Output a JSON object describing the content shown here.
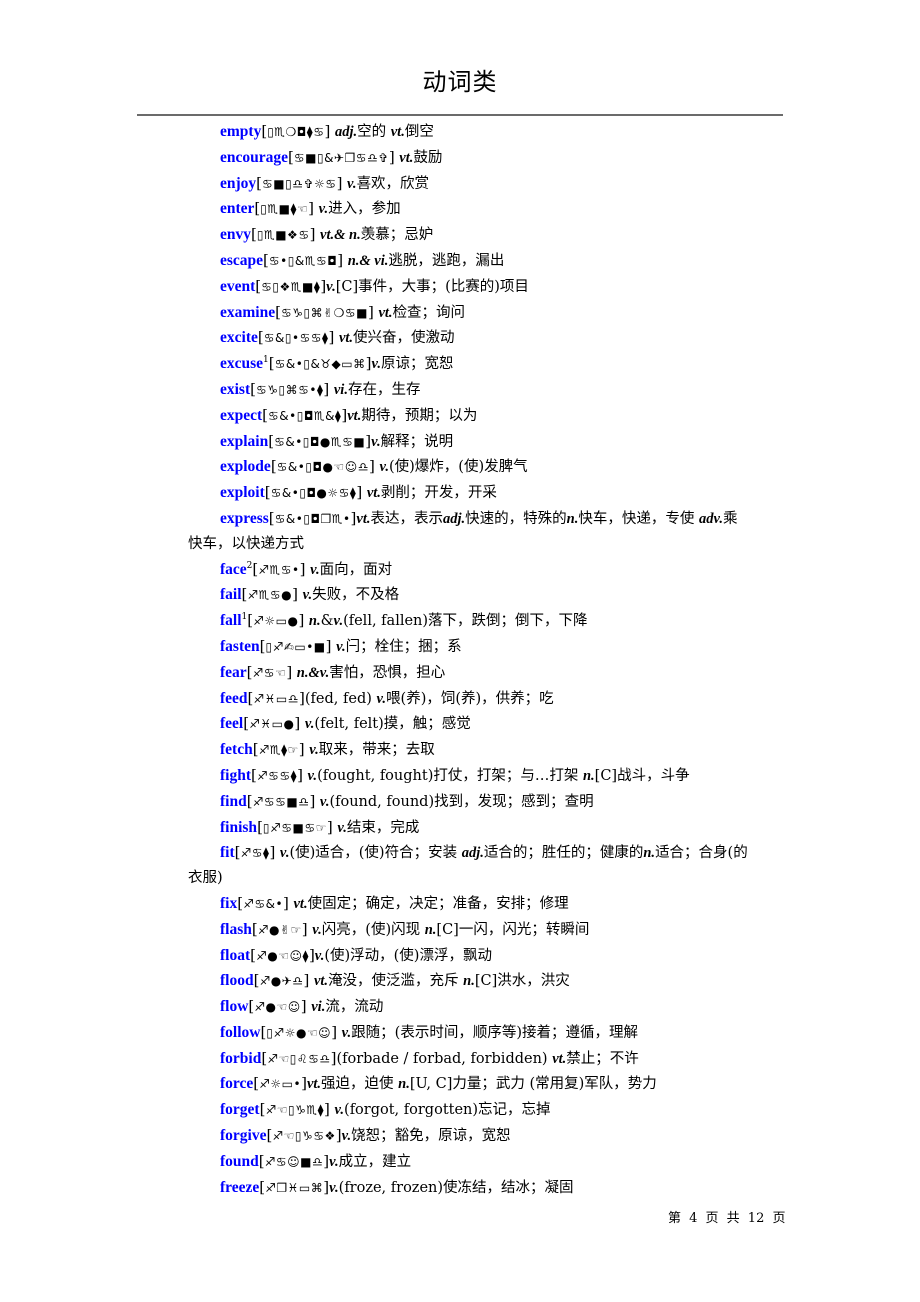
{
  "document": {
    "title": "动词类",
    "footer": "第 4 页 共 12 页"
  },
  "entries": [
    {
      "word": "empty",
      "sup": "",
      "phonetic": "▯♏❍◘⧫♋",
      "segments": [
        {
          "t": " "
        },
        {
          "pos": "adj."
        },
        {
          "t": "空的  "
        },
        {
          "pos": "vt."
        },
        {
          "t": "倒空"
        }
      ]
    },
    {
      "word": "encourage",
      "sup": "",
      "phonetic": "♋■▯&✈❐♋♎✞",
      "segments": [
        {
          "t": " "
        },
        {
          "pos": "vt."
        },
        {
          "t": "鼓励"
        }
      ]
    },
    {
      "word": "enjoy",
      "sup": "",
      "phonetic": "♋■▯♎✞☼♋",
      "segments": [
        {
          "t": " "
        },
        {
          "pos": "v."
        },
        {
          "t": "喜欢，欣赏"
        }
      ]
    },
    {
      "word": "enter",
      "sup": "",
      "phonetic": "▯♏■⧫☜",
      "segments": [
        {
          "t": " "
        },
        {
          "pos": "v."
        },
        {
          "t": "进入，参加"
        }
      ]
    },
    {
      "word": "envy",
      "sup": "",
      "phonetic": "▯♏■❖♋",
      "segments": [
        {
          "t": " "
        },
        {
          "pos": "vt.& n."
        },
        {
          "t": "羡慕；忌妒"
        }
      ]
    },
    {
      "word": "escape",
      "sup": "",
      "phonetic": "♋•▯&♏♋◘",
      "segments": [
        {
          "t": " "
        },
        {
          "pos": "n.& vi."
        },
        {
          "t": "逃脱，逃跑，漏出"
        }
      ]
    },
    {
      "word": "event",
      "sup": "",
      "phonetic": "♋▯❖♏■⧫",
      "segments": [
        {
          "pos": "v."
        },
        {
          "t": "[C]事件，大事；(比赛的)项目"
        }
      ]
    },
    {
      "word": "examine",
      "sup": "",
      "phonetic": "♋♑▯⌘✌❍♋■",
      "segments": [
        {
          "t": " "
        },
        {
          "pos": "vt."
        },
        {
          "t": "检查；询问"
        }
      ]
    },
    {
      "word": "excite",
      "sup": "",
      "phonetic": "♋&▯•♋♋⧫",
      "segments": [
        {
          "t": " "
        },
        {
          "pos": "vt."
        },
        {
          "t": "使兴奋，使激动"
        }
      ]
    },
    {
      "word": "excuse",
      "sup": "1",
      "phonetic": "♋&•▯&♉◆▭⌘",
      "segments": [
        {
          "pos": "v."
        },
        {
          "t": "原谅；宽恕"
        }
      ]
    },
    {
      "word": "exist",
      "sup": "",
      "phonetic": "♋♑▯⌘♋•⧫",
      "segments": [
        {
          "t": " "
        },
        {
          "pos": "vi."
        },
        {
          "t": "存在，生存"
        }
      ]
    },
    {
      "word": "expect",
      "sup": "",
      "phonetic": "♋&•▯◘♏&⧫",
      "segments": [
        {
          "pos": "vt."
        },
        {
          "t": "期待，预期；以为"
        }
      ]
    },
    {
      "word": "explain",
      "sup": "",
      "phonetic": "♋&•▯◘●♏♋■",
      "segments": [
        {
          "pos": "v."
        },
        {
          "t": "解释；说明"
        }
      ]
    },
    {
      "word": "explode",
      "sup": "",
      "phonetic": "♋&•▯◘●☜☺♎",
      "segments": [
        {
          "t": " "
        },
        {
          "pos": "v."
        },
        {
          "t": "(使)爆炸，(使)发脾气"
        }
      ]
    },
    {
      "word": "exploit",
      "sup": "",
      "phonetic": "♋&•▯◘●☼♋⧫",
      "segments": [
        {
          "t": " "
        },
        {
          "pos": "vt."
        },
        {
          "t": "剥削；开发，开采"
        }
      ]
    },
    {
      "word": "express",
      "sup": "",
      "phonetic": "♋&•▯◘❐♏•",
      "segments": [
        {
          "pos": "vt."
        },
        {
          "t": "表达，表示"
        },
        {
          "pos": "adj."
        },
        {
          "t": "快速的，特殊的"
        },
        {
          "pos": "n."
        },
        {
          "t": "快车，快递，专使  "
        },
        {
          "pos": "adv."
        },
        {
          "t": "乘快车，以快递方式"
        }
      ]
    },
    {
      "word": "face",
      "sup": "2",
      "phonetic": "♐♏♋•",
      "segments": [
        {
          "t": " "
        },
        {
          "pos": "v."
        },
        {
          "t": "面向，面对"
        }
      ]
    },
    {
      "word": "fail",
      "sup": "",
      "phonetic": "♐♏♋●",
      "segments": [
        {
          "t": " "
        },
        {
          "pos": "v."
        },
        {
          "t": "失败，不及格"
        }
      ]
    },
    {
      "word": "fall",
      "sup": "1",
      "phonetic": "♐☼▭●",
      "segments": [
        {
          "t": " "
        },
        {
          "pos": "n."
        },
        {
          "t": "&"
        },
        {
          "pos": "v."
        },
        {
          "t": "(fell,  fallen)落下，跌倒；倒下，下降"
        }
      ]
    },
    {
      "word": "fasten",
      "sup": "",
      "phonetic": "▯♐✍▭•■",
      "segments": [
        {
          "t": " "
        },
        {
          "pos": "v."
        },
        {
          "t": "闩；栓住；捆；系"
        }
      ]
    },
    {
      "word": "fear",
      "sup": "",
      "phonetic": "♐♋☜",
      "segments": [
        {
          "t": " "
        },
        {
          "pos": "n.&v."
        },
        {
          "t": "害怕，恐惧，担心"
        }
      ]
    },
    {
      "word": "feed",
      "sup": "",
      "phonetic": "♐♓▭♎",
      "segments": [
        {
          "t": "(fed,  fed)  "
        },
        {
          "pos": "v."
        },
        {
          "t": "喂(养)，饲(养)，供养；吃"
        }
      ]
    },
    {
      "word": "feel",
      "sup": "",
      "phonetic": "♐♓▭●",
      "segments": [
        {
          "t": " "
        },
        {
          "pos": "v."
        },
        {
          "t": "(felt,  felt)摸，触；感觉"
        }
      ]
    },
    {
      "word": "fetch",
      "sup": "",
      "phonetic": "♐♏⧫☞",
      "segments": [
        {
          "t": " "
        },
        {
          "pos": "v."
        },
        {
          "t": "取来，带来；去取"
        }
      ]
    },
    {
      "word": "fight",
      "sup": "",
      "phonetic": "♐♋♋⧫",
      "segments": [
        {
          "t": " "
        },
        {
          "pos": "v."
        },
        {
          "t": "(fought,  fought)打仗，打架；与…打架  "
        },
        {
          "pos": "n."
        },
        {
          "t": "[C]战斗，斗争"
        }
      ]
    },
    {
      "word": "find",
      "sup": "",
      "phonetic": "♐♋♋■♎",
      "segments": [
        {
          "t": " "
        },
        {
          "pos": "v."
        },
        {
          "t": "(found,  found)找到，发现；感到；查明"
        }
      ]
    },
    {
      "word": "finish",
      "sup": "",
      "phonetic": "▯♐♋■♋☞",
      "segments": [
        {
          "t": " "
        },
        {
          "pos": "v."
        },
        {
          "t": "结束，完成"
        }
      ]
    },
    {
      "word": "fit",
      "sup": "",
      "phonetic": "♐♋⧫",
      "segments": [
        {
          "t": " "
        },
        {
          "pos": "v."
        },
        {
          "t": "(使)适合，(使)符合；安装  "
        },
        {
          "pos": "adj."
        },
        {
          "t": "适合的；胜任的；健康的"
        },
        {
          "pos": "n."
        },
        {
          "t": "适合；合身(的衣服)"
        }
      ]
    },
    {
      "word": "fix",
      "sup": "",
      "phonetic": "♐♋&•",
      "segments": [
        {
          "t": " "
        },
        {
          "pos": "vt."
        },
        {
          "t": "使固定；确定，决定；准备，安排；修理"
        }
      ]
    },
    {
      "word": "flash",
      "sup": "",
      "phonetic": "♐●✌☞",
      "segments": [
        {
          "t": " "
        },
        {
          "pos": "v."
        },
        {
          "t": "闪亮，(使)闪现  "
        },
        {
          "pos": "n."
        },
        {
          "t": "[C]一闪，闪光；转瞬间"
        }
      ]
    },
    {
      "word": "float",
      "sup": "",
      "phonetic": "♐●☜☺⧫",
      "segments": [
        {
          "pos": "v."
        },
        {
          "t": "(使)浮动，(使)漂浮，飘动"
        }
      ]
    },
    {
      "word": "flood",
      "sup": "",
      "phonetic": "♐●✈♎",
      "segments": [
        {
          "t": " "
        },
        {
          "pos": "vt."
        },
        {
          "t": "淹没，使泛滥，充斥  "
        },
        {
          "pos": "n."
        },
        {
          "t": "[C]洪水，洪灾"
        }
      ]
    },
    {
      "word": "flow",
      "sup": "",
      "phonetic": "♐●☜☺",
      "segments": [
        {
          "t": " "
        },
        {
          "pos": "vi."
        },
        {
          "t": "流，流动"
        }
      ]
    },
    {
      "word": "follow",
      "sup": "",
      "phonetic": "▯♐☼●☜☺",
      "segments": [
        {
          "t": " "
        },
        {
          "pos": "v."
        },
        {
          "t": "跟随；(表示时间，顺序等)接着；遵循，理解"
        }
      ]
    },
    {
      "word": "forbid",
      "sup": "",
      "phonetic": "♐☜▯♌♋♎",
      "segments": [
        {
          "t": "(forbade  /  forbad,  forbidden) "
        },
        {
          "pos": "vt."
        },
        {
          "t": "禁止；不许"
        }
      ]
    },
    {
      "word": "force",
      "sup": "",
      "phonetic": "♐☼▭•",
      "segments": [
        {
          "pos": "vt."
        },
        {
          "t": "强迫，迫使  "
        },
        {
          "pos": "n."
        },
        {
          "t": "[U, C]力量；武力 (常用复)军队，势力"
        }
      ]
    },
    {
      "word": "forget",
      "sup": "",
      "phonetic": "♐☜▯♑♏⧫",
      "segments": [
        {
          "t": " "
        },
        {
          "pos": "v."
        },
        {
          "t": "(forgot,  forgotten)忘记，忘掉"
        }
      ]
    },
    {
      "word": "forgive",
      "sup": "",
      "phonetic": "♐☜▯♑♋❖",
      "segments": [
        {
          "pos": "v."
        },
        {
          "t": "饶恕；豁免，原谅，宽恕"
        }
      ]
    },
    {
      "word": "found",
      "sup": "",
      "phonetic": "♐♋☺■♎",
      "segments": [
        {
          "pos": "v."
        },
        {
          "t": "成立，建立"
        }
      ]
    },
    {
      "word": "freeze",
      "sup": "",
      "phonetic": "♐❐♓▭⌘",
      "segments": [
        {
          "pos": "v."
        },
        {
          "t": "(froze,  frozen)使冻结，结冰；凝固"
        }
      ]
    }
  ]
}
